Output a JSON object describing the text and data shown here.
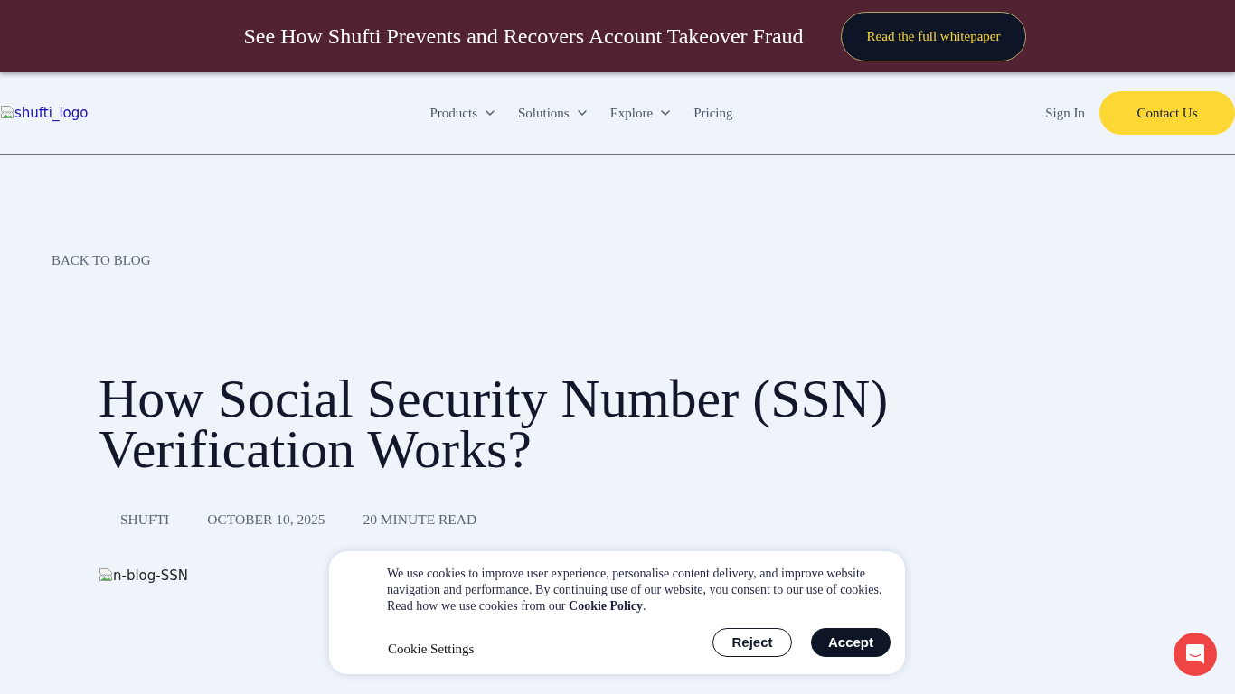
{
  "announcement": {
    "text": "See How Shufti Prevents and Recovers Account Takeover Fraud",
    "button": "Read the full whitepaper"
  },
  "header": {
    "logo_alt": "shufti_logo",
    "nav": [
      {
        "label": "Products",
        "dropdown": true
      },
      {
        "label": "Solutions",
        "dropdown": true
      },
      {
        "label": "Explore",
        "dropdown": true
      },
      {
        "label": "Pricing",
        "dropdown": false
      }
    ],
    "sign_in": "Sign In",
    "contact_button": "Contact Us"
  },
  "article": {
    "back_link": "BACK TO BLOG",
    "title": "How Social Security Number (SSN) Verification Works?",
    "meta": [
      "SHUFTI",
      "OCTOBER 10, 2025",
      "20 MINUTE READ"
    ],
    "image_alt": "n-blog-SSN"
  },
  "cookie_banner": {
    "text": "We use cookies to improve user experience, personalise content delivery, and improve website navigation and performance. By continuing use of our website, you consent to our use of cookies. Read how we use cookies from our **Cookie Policy**.",
    "settings_link": "Cookie Settings",
    "buttons": [
      {
        "label": "Reject",
        "kind": "outline"
      },
      {
        "label": "Accept",
        "kind": "filled"
      }
    ]
  }
}
